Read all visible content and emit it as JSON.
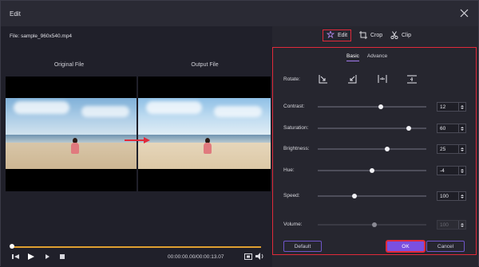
{
  "window": {
    "title": "Edit"
  },
  "player": {
    "file_label": "File: sample_960x540.mp4",
    "original_label": "Original File",
    "output_label": "Output File",
    "time": "00:00:00.00/00:00:13.07",
    "progress": 0.0
  },
  "topnav": [
    {
      "label": "Edit",
      "icon": "magic-wand-icon",
      "active": true
    },
    {
      "label": "Crop",
      "icon": "crop-icon",
      "active": false
    },
    {
      "label": "Clip",
      "icon": "scissors-icon",
      "active": false
    }
  ],
  "subtabs": {
    "basic": "Basic",
    "advance": "Advance"
  },
  "rotate": {
    "label": "Rotate:"
  },
  "adjust": {
    "contrast": {
      "label": "Contrast:",
      "value": "12",
      "level": 0.58
    },
    "saturation": {
      "label": "Saturation:",
      "value": "60",
      "level": 0.84
    },
    "brightness": {
      "label": "Brightness:",
      "value": "25",
      "level": 0.64
    },
    "hue": {
      "label": "Hue:",
      "value": "-4",
      "level": 0.5
    },
    "speed": {
      "label": "Speed:",
      "value": "100",
      "level": 0.34
    },
    "volume": {
      "label": "Volume:",
      "value": "100",
      "level": 0.52
    }
  },
  "buttons": {
    "default": "Default",
    "ok": "OK",
    "cancel": "Cancel"
  },
  "colors": {
    "accent": "#7b4fe0",
    "highlight": "#e02a3a",
    "timeline": "#e0a030"
  }
}
